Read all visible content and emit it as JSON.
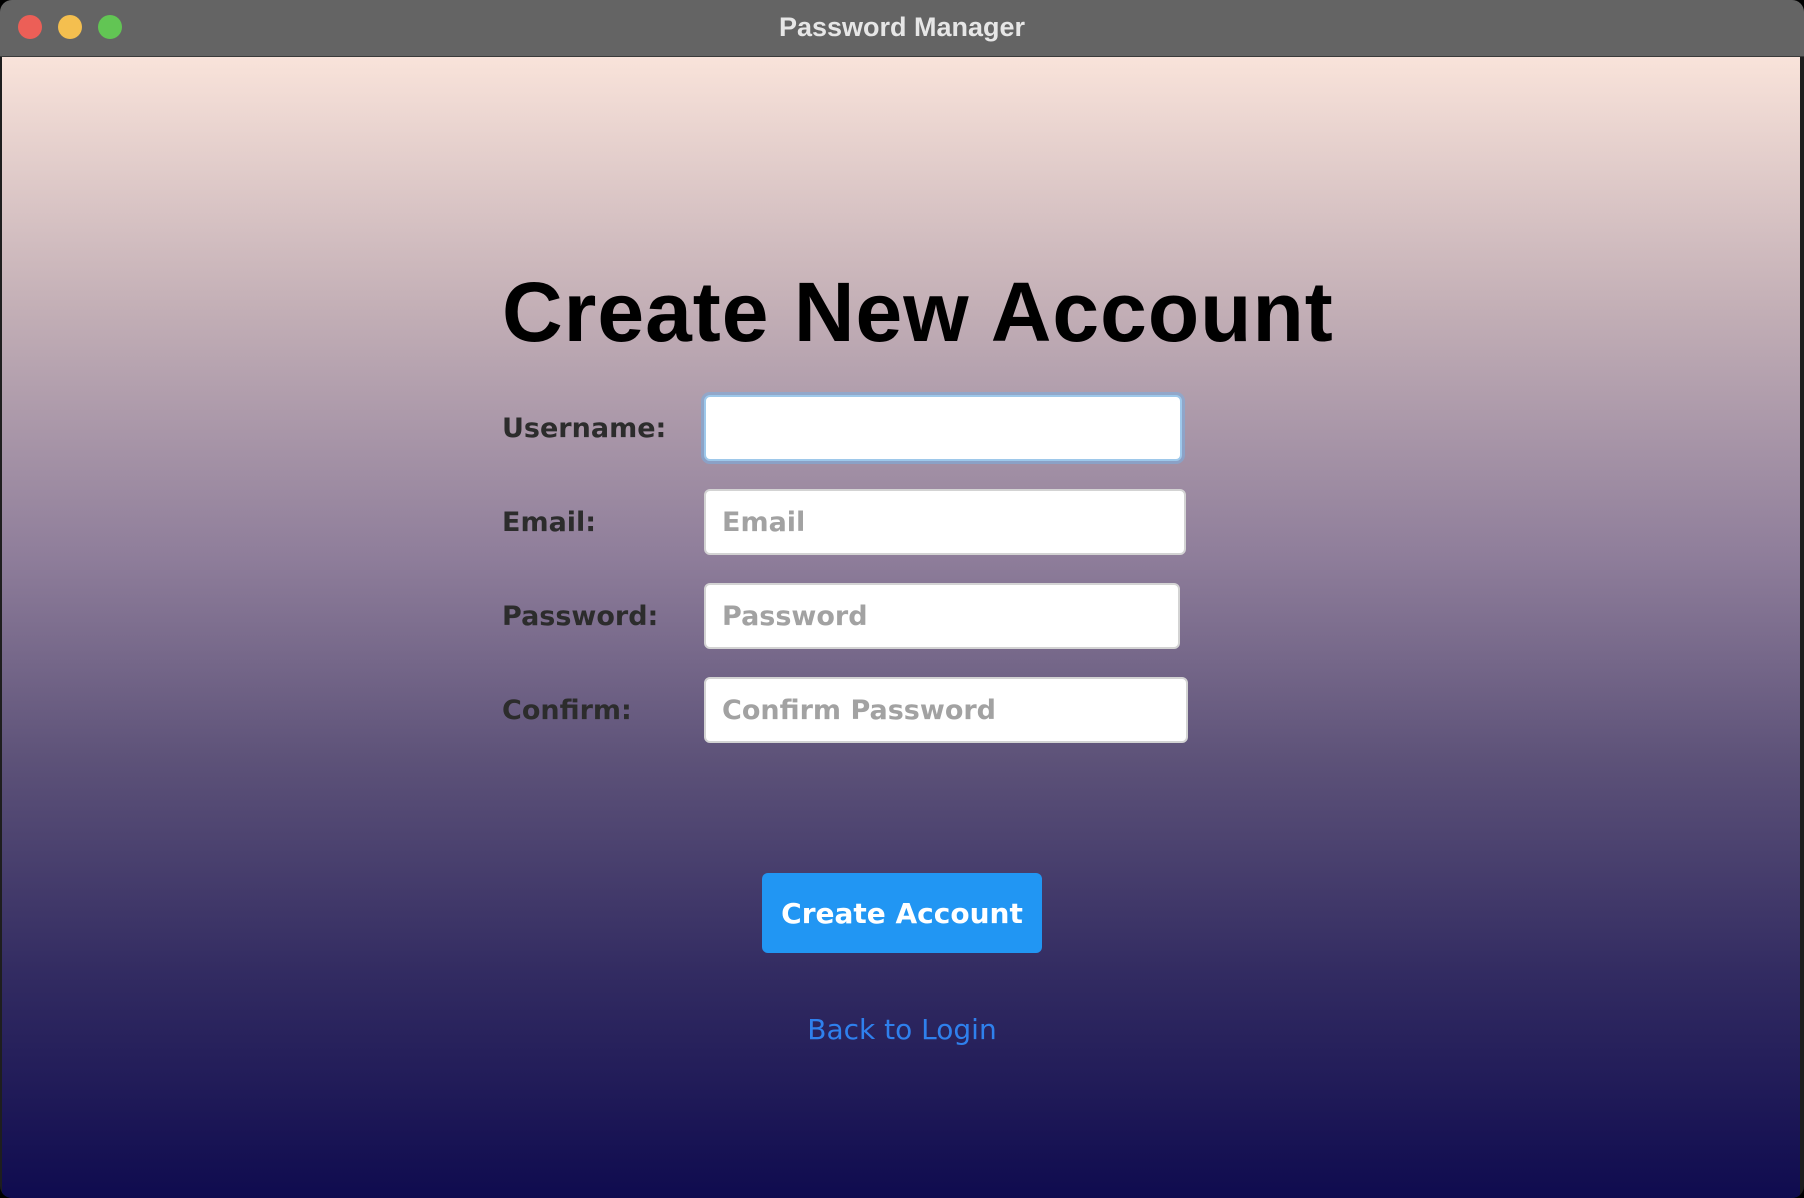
{
  "window": {
    "title": "Password Manager"
  },
  "form": {
    "heading": "Create New Account",
    "fields": [
      {
        "label": "Username:",
        "value": "",
        "placeholder": ""
      },
      {
        "label": "Email:",
        "value": "",
        "placeholder": "Email"
      },
      {
        "label": "Password:",
        "value": "",
        "placeholder": "Password"
      },
      {
        "label": "Confirm:",
        "value": "",
        "placeholder": "Confirm Password"
      }
    ],
    "submit_label": "Create Account",
    "back_link": "Back to Login"
  },
  "colors": {
    "primary_button": "#2196f3",
    "link": "#2f80ed",
    "titlebar": "#646464",
    "gradient_top": "#f9e3da",
    "gradient_bottom": "#0f0b4f"
  }
}
